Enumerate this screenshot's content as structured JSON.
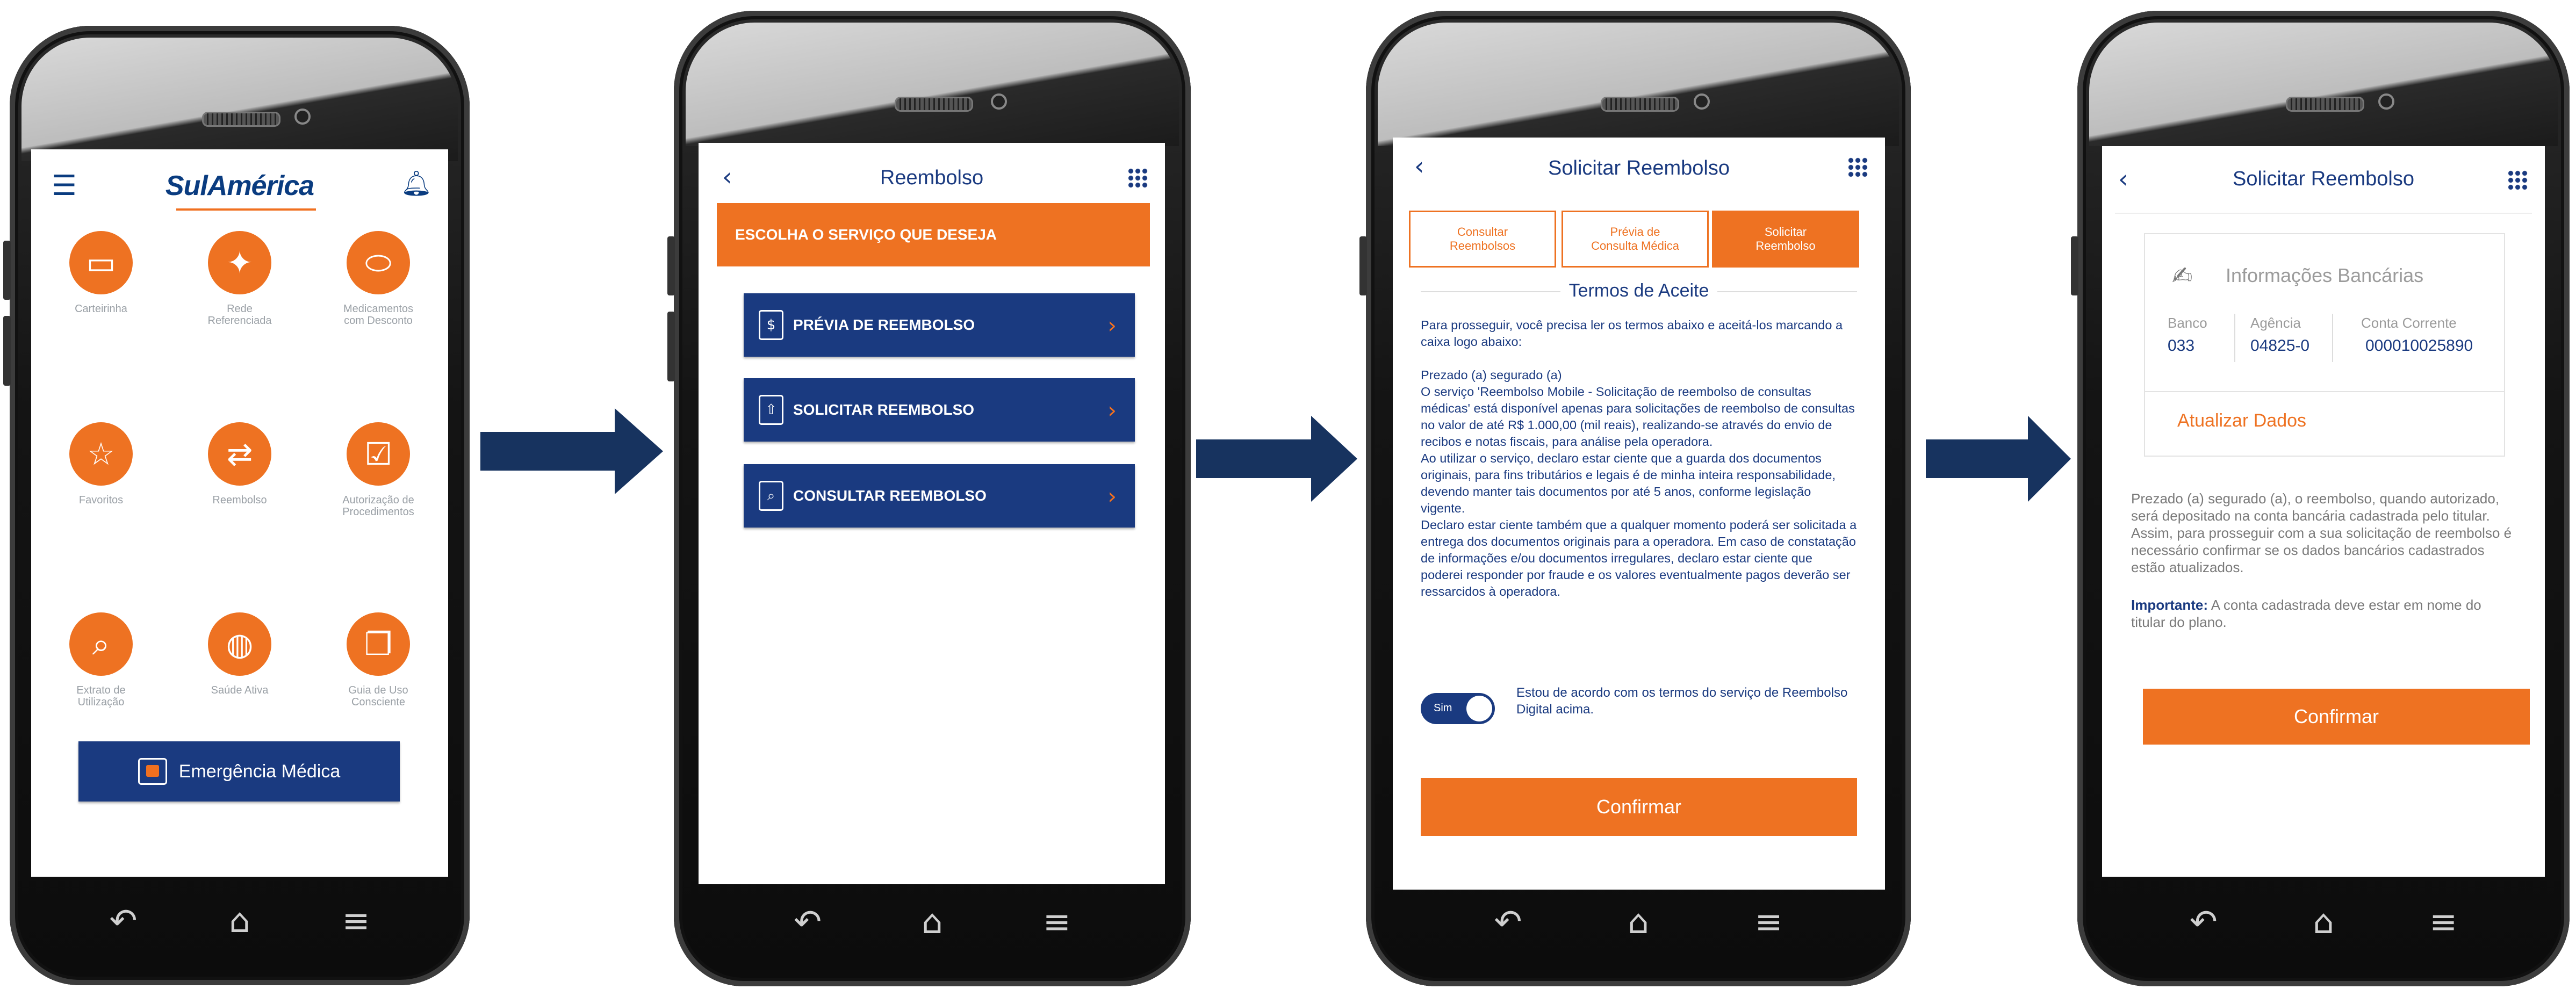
{
  "screen1": {
    "logo": "SulAmérica",
    "grid": [
      {
        "icon": "card-icon",
        "glyph": "▭",
        "label": "Carteirinha"
      },
      {
        "icon": "brazil-map-icon",
        "glyph": "✦",
        "label": "Rede\nReferenciada"
      },
      {
        "icon": "pill-icon",
        "glyph": "⬭",
        "label": "Medicamentos\ncom Desconto"
      },
      {
        "icon": "star-icon",
        "glyph": "☆",
        "label": "Favoritos"
      },
      {
        "icon": "swap-arrows-icon",
        "glyph": "⇄",
        "label": "Reembolso"
      },
      {
        "icon": "clipboard-check-icon",
        "glyph": "☑",
        "label": "Autorização de\nProcedimentos"
      },
      {
        "icon": "magnifier-icon",
        "glyph": "⌕",
        "label": "Extrato de\nUtilização"
      },
      {
        "icon": "apple-icon",
        "glyph": "◍",
        "label": "Saúde Ativa"
      },
      {
        "icon": "book-icon",
        "glyph": "❐",
        "label": "Guia de Uso\nConsciente"
      }
    ],
    "emergency_label": "Emergência Médica"
  },
  "screen2": {
    "title": "Reembolso",
    "banner": "ESCOLHA O SERVIÇO QUE DESEJA",
    "services": [
      {
        "icon": "dollar-document-icon",
        "glyph": "$",
        "label": "PRÉVIA DE REEMBOLSO"
      },
      {
        "icon": "money-upload-icon",
        "glyph": "⇧",
        "label": "SOLICITAR REEMBOLSO"
      },
      {
        "icon": "search-document-icon",
        "glyph": "⌕",
        "label": "CONSULTAR REEMBOLSO"
      }
    ]
  },
  "screen3": {
    "title": "Solicitar Reembolso",
    "tabs": [
      "Consultar\nReembolsos",
      "Prévia de\nConsulta Médica",
      "Solicitar\nReembolso"
    ],
    "section_title": "Termos de Aceite",
    "intro": "Para prosseguir, você precisa ler os termos abaixo e aceitá-los marcando a caixa logo abaixo:",
    "terms": "Prezado (a) segurado (a)\nO serviço 'Reembolso Mobile - Solicitação de reembolso de consultas médicas' está disponível apenas para solicitações de reembolso de consultas no valor de até R$ 1.000,00 (mil reais), realizando-se através do envio de recibos e notas fiscais, para análise pela operadora.\nAo utilizar o serviço, declaro estar ciente que a guarda dos documentos originais, para fins tributários e legais é de minha inteira responsabilidade, devendo manter tais documentos por até 5 anos, conforme legislação vigente.\nDeclaro estar ciente também que a qualquer momento poderá ser solicitada a entrega dos documentos originais para a operadora. Em caso de constatação de informações e/ou documentos irregulares, declaro estar ciente que poderei responder por fraude e os valores eventualmente pagos deverão ser ressarcidos à operadora.",
    "toggle_label": "Sim",
    "agree_text": "Estou de acordo com os termos do serviço de Reembolso Digital acima.",
    "confirm": "Confirmar"
  },
  "screen4": {
    "title": "Solicitar Reembolso",
    "card_title": "Informações Bancárias",
    "bank_label": "Banco",
    "bank_value": "033",
    "agency_label": "Agência",
    "agency_value": "04825-0",
    "account_label": "Conta Corrente",
    "account_value": "000010025890",
    "update_link": "Atualizar Dados",
    "info": "Prezado (a) segurado (a), o reembolso, quando autorizado, será depositado na conta bancária cadastrada pelo titular. Assim, para prosseguir com a sua solicitação de reembolso é necessário confirmar se os dados bancários cadastrados estão atualizados.",
    "important_label": "Importante:",
    "important_text": " A conta cadastrada deve estar em nome do titular do plano.",
    "confirm": "Confirmar"
  },
  "nav_glyphs": {
    "back": "↶",
    "home": "⌂",
    "menu": "≡"
  },
  "colors": {
    "brand_blue": "#1a3a80",
    "brand_orange": "#ee7222"
  }
}
